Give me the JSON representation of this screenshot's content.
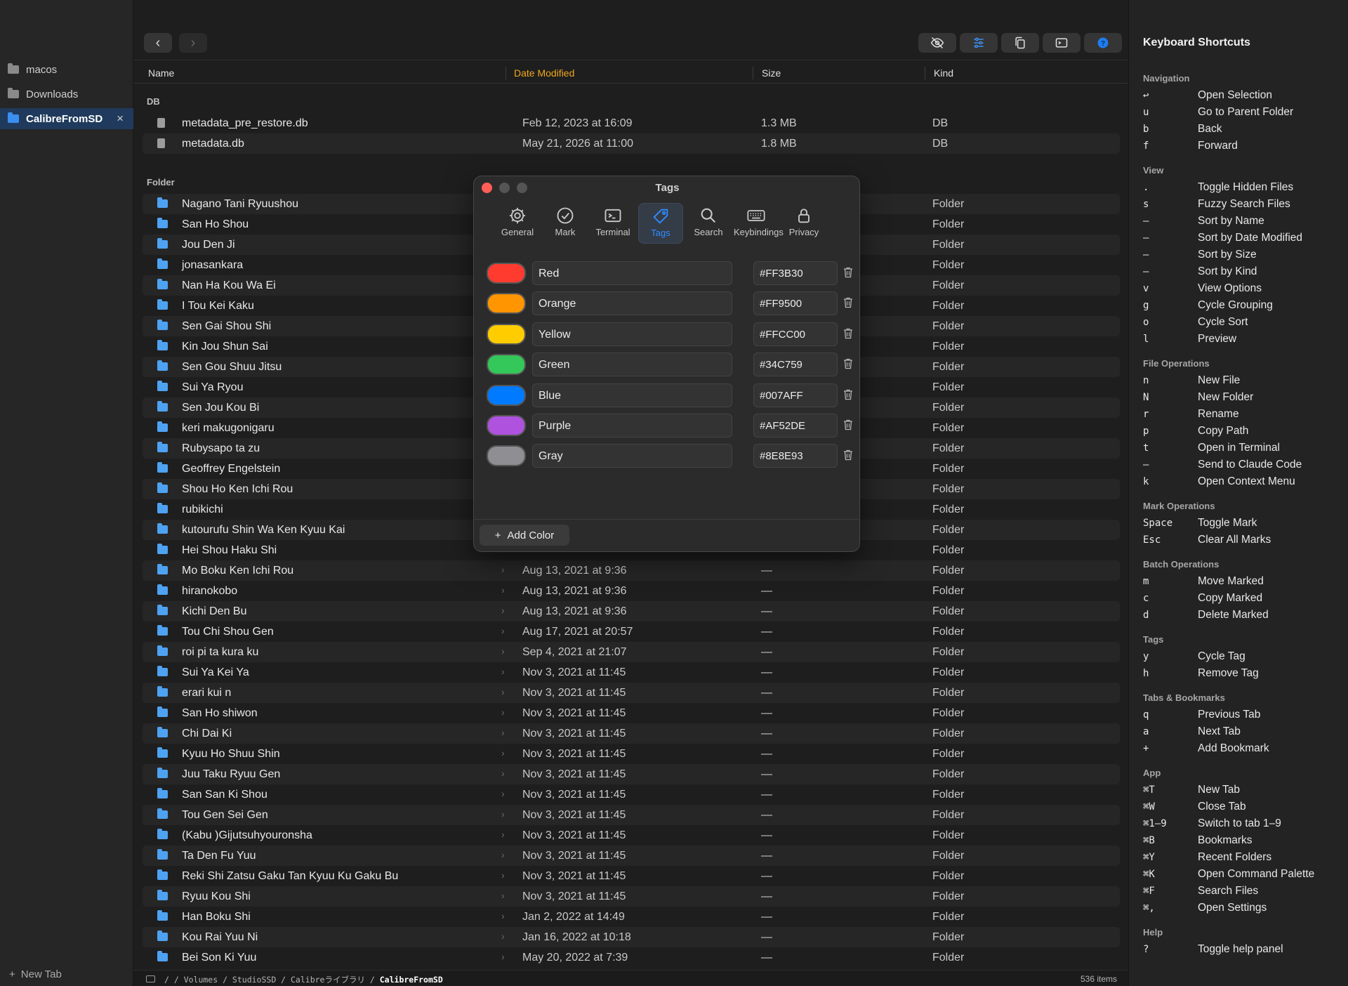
{
  "sidebar": {
    "items": [
      {
        "label": "macos"
      },
      {
        "label": "Downloads"
      },
      {
        "label": "CalibreFromSD",
        "close": "×"
      }
    ],
    "new_tab": "New Tab",
    "new_tab_icon": "+"
  },
  "toolbar": {
    "back": "‹",
    "forward": "›",
    "buttons": [
      "eye-slash-icon",
      "sliders-icon",
      "copy-icon",
      "terminal-icon",
      "help-icon"
    ]
  },
  "columns": {
    "name": "Name",
    "date": "Date Modified",
    "size": "Size",
    "kind": "Kind"
  },
  "groups": {
    "db": "DB",
    "folder": "Folder"
  },
  "db_files": [
    {
      "name": "metadata_pre_restore.db",
      "date": "Feb 12, 2023 at 16:09",
      "size": "1.3 MB",
      "kind": "DB"
    },
    {
      "name": "metadata.db",
      "date": "May 21, 2026 at 11:00",
      "size": "1.8 MB",
      "kind": "DB"
    }
  ],
  "folders": [
    {
      "name": "Nagano Tani Ryuushou",
      "date": "",
      "size": "",
      "kind": "Folder"
    },
    {
      "name": "San Ho Shou",
      "date": "",
      "size": "",
      "kind": "Folder"
    },
    {
      "name": "Jou Den Ji",
      "date": "",
      "size": "",
      "kind": "Folder"
    },
    {
      "name": "jonasankara",
      "date": "",
      "size": "",
      "kind": "Folder"
    },
    {
      "name": "Nan Ha Kou Wa Ei",
      "date": "",
      "size": "",
      "kind": "Folder"
    },
    {
      "name": "I Tou Kei Kaku",
      "date": "",
      "size": "",
      "kind": "Folder"
    },
    {
      "name": "Sen Gai Shou Shi",
      "date": "",
      "size": "",
      "kind": "Folder"
    },
    {
      "name": "Kin Jou Shun Sai",
      "date": "",
      "size": "",
      "kind": "Folder"
    },
    {
      "name": "Sen Gou  Shuu Jitsu",
      "date": "",
      "size": "",
      "kind": "Folder"
    },
    {
      "name": "Sui Ya Ryou",
      "date": "",
      "size": "",
      "kind": "Folder"
    },
    {
      "name": "Sen Jou Kou Bi",
      "date": "",
      "size": "",
      "kind": "Folder"
    },
    {
      "name": "keri  makugonigaru",
      "date": "",
      "size": "",
      "kind": "Folder"
    },
    {
      "name": "Rubysapo ta zu",
      "date": "",
      "size": "",
      "kind": "Folder"
    },
    {
      "name": "Geoffrey Engelstein",
      "date": "",
      "size": "",
      "kind": "Folder"
    },
    {
      "name": "Shou Ho Ken Ichi Rou",
      "date": "",
      "size": "",
      "kind": "Folder"
    },
    {
      "name": "rubikichi",
      "date": "",
      "size": "",
      "kind": "Folder"
    },
    {
      "name": "kutourufu Shin Wa Ken Kyuu Kai",
      "date": "",
      "size": "",
      "kind": "Folder"
    },
    {
      "name": "Hei Shou Haku Shi",
      "date": "",
      "size": "",
      "kind": "Folder"
    },
    {
      "name": "Mo Boku Ken Ichi Rou",
      "date": "Aug 13, 2021 at 9:36",
      "size": "—",
      "kind": "Folder"
    },
    {
      "name": "hiranokobo",
      "date": "Aug 13, 2021 at 9:36",
      "size": "—",
      "kind": "Folder"
    },
    {
      "name": "Kichi Den Bu",
      "date": "Aug 13, 2021 at 9:36",
      "size": "—",
      "kind": "Folder"
    },
    {
      "name": "Tou Chi Shou Gen",
      "date": "Aug 17, 2021 at 20:57",
      "size": "—",
      "kind": "Folder"
    },
    {
      "name": "roi pi ta  kura ku",
      "date": "Sep 4, 2021 at 21:07",
      "size": "—",
      "kind": "Folder"
    },
    {
      "name": "Sui Ya Kei Ya",
      "date": "Nov 3, 2021 at 11:45",
      "size": "—",
      "kind": "Folder"
    },
    {
      "name": "erari kui n",
      "date": "Nov 3, 2021 at 11:45",
      "size": "—",
      "kind": "Folder"
    },
    {
      "name": "San Ho shiwon",
      "date": "Nov 3, 2021 at 11:45",
      "size": "—",
      "kind": "Folder"
    },
    {
      "name": "Chi Dai Ki",
      "date": "Nov 3, 2021 at 11:45",
      "size": "—",
      "kind": "Folder"
    },
    {
      "name": "Kyuu Ho Shuu Shin",
      "date": "Nov 3, 2021 at 11:45",
      "size": "—",
      "kind": "Folder"
    },
    {
      "name": "Juu Taku Ryuu Gen",
      "date": "Nov 3, 2021 at 11:45",
      "size": "—",
      "kind": "Folder"
    },
    {
      "name": "San San Ki Shou",
      "date": "Nov 3, 2021 at 11:45",
      "size": "—",
      "kind": "Folder"
    },
    {
      "name": "Tou Gen Sei Gen",
      "date": "Nov 3, 2021 at 11:45",
      "size": "—",
      "kind": "Folder"
    },
    {
      "name": "(Kabu )Gijutsuhyouronsha",
      "date": "Nov 3, 2021 at 11:45",
      "size": "—",
      "kind": "Folder"
    },
    {
      "name": "Ta Den Fu Yuu",
      "date": "Nov 3, 2021 at 11:45",
      "size": "—",
      "kind": "Folder"
    },
    {
      "name": "Reki Shi Zatsu Gaku Tan Kyuu Ku Gaku Bu",
      "date": "Nov 3, 2021 at 11:45",
      "size": "—",
      "kind": "Folder"
    },
    {
      "name": "Ryuu Kou Shi",
      "date": "Nov 3, 2021 at 11:45",
      "size": "—",
      "kind": "Folder"
    },
    {
      "name": "Han Boku Shi",
      "date": "Jan 2, 2022 at 14:49",
      "size": "—",
      "kind": "Folder"
    },
    {
      "name": "Kou Rai Yuu Ni",
      "date": "Jan 16, 2022 at 10:18",
      "size": "—",
      "kind": "Folder"
    },
    {
      "name": "Bei Son Ki Yuu",
      "date": "May 20, 2022 at 7:39",
      "size": "—",
      "kind": "Folder"
    }
  ],
  "chevron": "›",
  "status": {
    "path_prefix": "/ / Volumes / StudioSSD / Calibreライブラリ / ",
    "path_current": "CalibreFromSD",
    "count": "536 items"
  },
  "dialog": {
    "title": "Tags",
    "tabs": [
      {
        "label": "General",
        "icon": "gear-icon"
      },
      {
        "label": "Mark",
        "icon": "checkmark-circle-icon"
      },
      {
        "label": "Terminal",
        "icon": "terminal-icon"
      },
      {
        "label": "Tags",
        "icon": "tag-icon"
      },
      {
        "label": "Search",
        "icon": "search-icon"
      },
      {
        "label": "Keybindings",
        "icon": "keyboard-icon"
      },
      {
        "label": "Privacy",
        "icon": "lock-icon"
      }
    ],
    "active_tab": "Tags",
    "tags": [
      {
        "name": "Red",
        "hex": "#FF3B30"
      },
      {
        "name": "Orange",
        "hex": "#FF9500"
      },
      {
        "name": "Yellow",
        "hex": "#FFCC00"
      },
      {
        "name": "Green",
        "hex": "#34C759"
      },
      {
        "name": "Blue",
        "hex": "#007AFF"
      },
      {
        "name": "Purple",
        "hex": "#AF52DE"
      },
      {
        "name": "Gray",
        "hex": "#8E8E93"
      }
    ],
    "add_label": "Add Color",
    "add_icon": "+"
  },
  "help": {
    "title": "Keyboard Shortcuts",
    "sections": [
      {
        "title": "Navigation",
        "items": [
          [
            "↩",
            "Open Selection"
          ],
          [
            "u",
            "Go to Parent Folder"
          ],
          [
            "b",
            "Back"
          ],
          [
            "f",
            "Forward"
          ]
        ]
      },
      {
        "title": "View",
        "items": [
          [
            ".",
            "Toggle Hidden Files"
          ],
          [
            "s",
            "Fuzzy Search Files"
          ],
          [
            "—",
            "Sort by Name"
          ],
          [
            "—",
            "Sort by Date Modified"
          ],
          [
            "—",
            "Sort by Size"
          ],
          [
            "—",
            "Sort by Kind"
          ],
          [
            "v",
            "View Options"
          ],
          [
            "g",
            "Cycle Grouping"
          ],
          [
            "o",
            "Cycle Sort"
          ],
          [
            "l",
            "Preview"
          ]
        ]
      },
      {
        "title": "File Operations",
        "items": [
          [
            "n",
            "New File"
          ],
          [
            "N",
            "New Folder"
          ],
          [
            "r",
            "Rename"
          ],
          [
            "p",
            "Copy Path"
          ],
          [
            "t",
            "Open in Terminal"
          ],
          [
            "—",
            "Send to Claude Code"
          ],
          [
            "k",
            "Open Context Menu"
          ]
        ]
      },
      {
        "title": "Mark Operations",
        "items": [
          [
            "Space",
            "Toggle Mark"
          ],
          [
            "Esc",
            "Clear All Marks"
          ]
        ]
      },
      {
        "title": "Batch Operations",
        "items": [
          [
            "m",
            "Move Marked"
          ],
          [
            "c",
            "Copy Marked"
          ],
          [
            "d",
            "Delete Marked"
          ]
        ]
      },
      {
        "title": "Tags",
        "items": [
          [
            "y",
            "Cycle Tag"
          ],
          [
            "h",
            "Remove Tag"
          ]
        ]
      },
      {
        "title": "Tabs & Bookmarks",
        "items": [
          [
            "q",
            "Previous Tab"
          ],
          [
            "a",
            "Next Tab"
          ],
          [
            "+",
            "Add Bookmark"
          ]
        ]
      },
      {
        "title": "App",
        "items": [
          [
            "⌘T",
            "New Tab"
          ],
          [
            "⌘W",
            "Close Tab"
          ],
          [
            "⌘1–9",
            "Switch to tab 1–9"
          ],
          [
            "⌘B",
            "Bookmarks"
          ],
          [
            "⌘Y",
            "Recent Folders"
          ],
          [
            "⌘K",
            "Open Command Palette"
          ],
          [
            "⌘F",
            "Search Files"
          ],
          [
            "⌘,",
            "Open Settings"
          ]
        ]
      },
      {
        "title": "Help",
        "items": [
          [
            "?",
            "Toggle help panel"
          ]
        ]
      }
    ]
  }
}
